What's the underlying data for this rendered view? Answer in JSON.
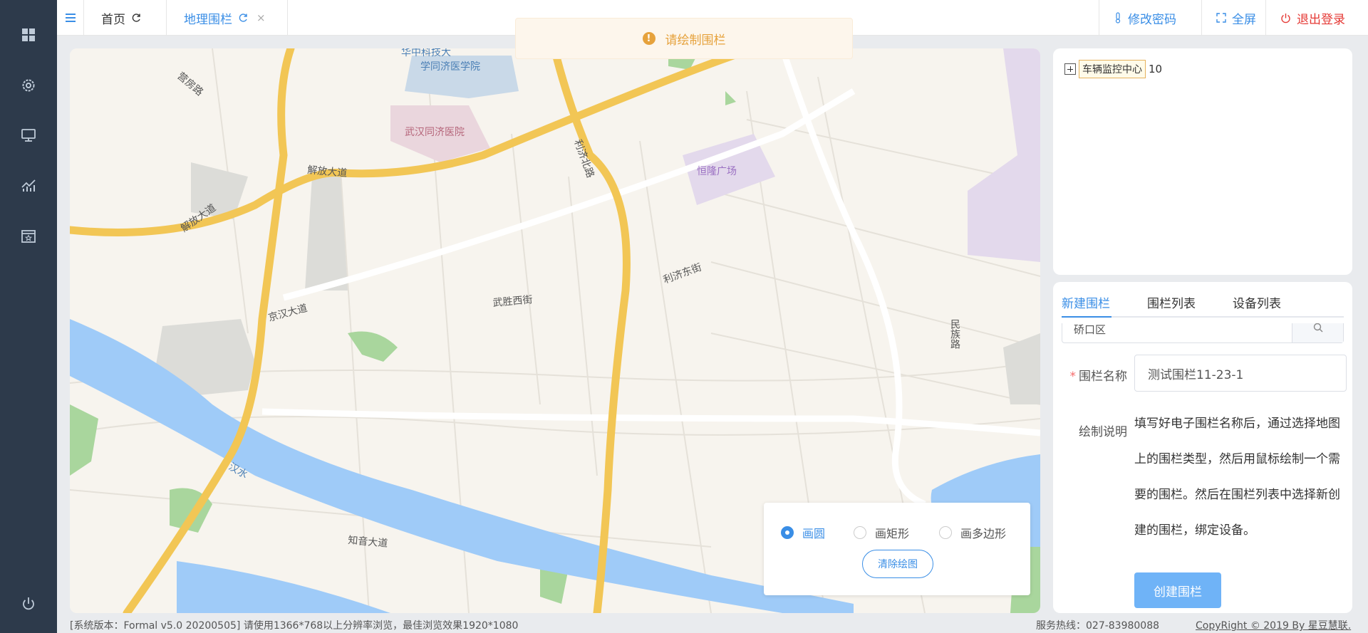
{
  "header": {
    "tabs": [
      {
        "label": "首页"
      },
      {
        "label": "地理围栏",
        "close": "×"
      }
    ],
    "change_password": "修改密码",
    "fullscreen": "全屏",
    "logout": "退出登录"
  },
  "toast": {
    "message": "请绘制围栏"
  },
  "map": {
    "labels": {
      "hust": "华中科技大",
      "hust2": "学同济医学院",
      "hospital": "武汉同济医院",
      "yingfang": "营房路",
      "jiefang1": "解放大道",
      "jiefang2": "解放大道",
      "liji_north": "利济北路",
      "henglong": "恒隆广场",
      "liji_east": "利济东街",
      "jinghan": "京汉大道",
      "wusheng": "武胜西街",
      "minzu": "民族路",
      "hanshui": "汉水",
      "zhiyin": "知音大道"
    }
  },
  "draw_tools": {
    "options": [
      "画圆",
      "画矩形",
      "画多边形"
    ],
    "selected": "画圆",
    "clear_label": "清除绘图"
  },
  "tree": {
    "node_label": "车辆监控中心",
    "node_count": "10"
  },
  "form": {
    "tabs": [
      "新建围栏",
      "围栏列表",
      "设备列表"
    ],
    "active_tab": "新建围栏",
    "partial_value": "硚口区",
    "name_label": "围栏名称",
    "name_value": "测试围栏11-23-1",
    "desc_label": "绘制说明",
    "desc_text": "填写好电子围栏名称后，通过选择地图上的围栏类型，然后用鼠标绘制一个需要的围栏。然后在围栏列表中选择新创建的围栏，绑定设备。",
    "create_label": "创建围栏"
  },
  "footer": {
    "version": "[系统版本：Formal v5.0 20200505] 请使用1366*768以上分辨率浏览，最佳浏览效果1920*1080",
    "hotline": "服务热线：027-83980088",
    "copyright": "CopyRight © 2019 By 星豆慧联."
  },
  "colors": {
    "sidebar": "#2d3a4b",
    "accent": "#3a8ee6",
    "danger": "#e53935",
    "warning": "#e6a23c",
    "primary_button": "#6fb3f7"
  },
  "icons": {
    "sidebar": [
      "dashboard-icon",
      "settings-icon",
      "monitor-icon",
      "chart-icon",
      "calendar-icon",
      "power-icon"
    ],
    "header": [
      "menu-icon",
      "refresh-icon",
      "thermometer-icon",
      "fullscreen-icon",
      "power-icon"
    ]
  }
}
